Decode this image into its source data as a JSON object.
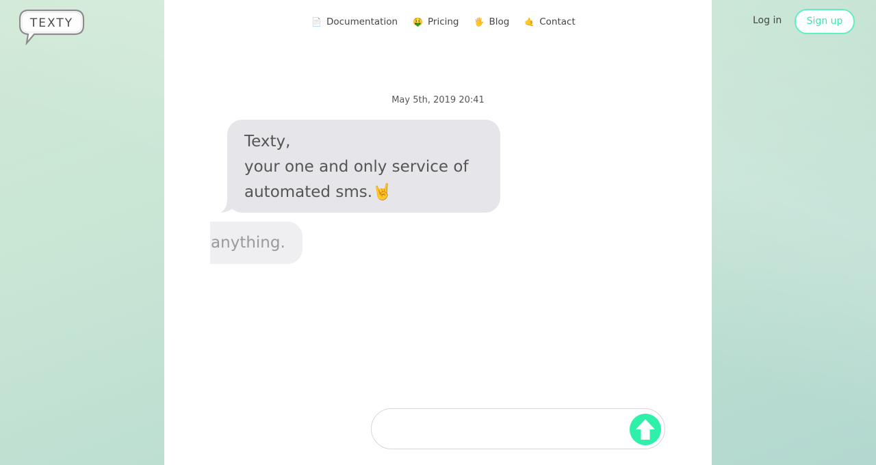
{
  "brand": {
    "logo_text": "TEXTY"
  },
  "nav": {
    "items": [
      {
        "emoji": "📄",
        "label": "Documentation"
      },
      {
        "emoji": "🤑",
        "label": "Pricing"
      },
      {
        "emoji": "🖐",
        "label": "Blog"
      },
      {
        "emoji": "🤙",
        "label": "Contact"
      }
    ]
  },
  "auth": {
    "login_label": "Log in",
    "signup_label": "Sign up"
  },
  "chat": {
    "timestamp": "May 5th, 2019 20:41",
    "message1": {
      "lines": [
        "Texty,",
        "your one and only service of",
        "automated sms.🤘"
      ]
    },
    "message2_visible_text": "ne anything."
  },
  "composer": {
    "placeholder": "",
    "value": ""
  },
  "colors": {
    "accent": "#2ef0a8",
    "signup_border": "#5ff0c2",
    "bubble": "#e5e5ea"
  },
  "icons": {
    "send": "arrow-up-icon"
  }
}
